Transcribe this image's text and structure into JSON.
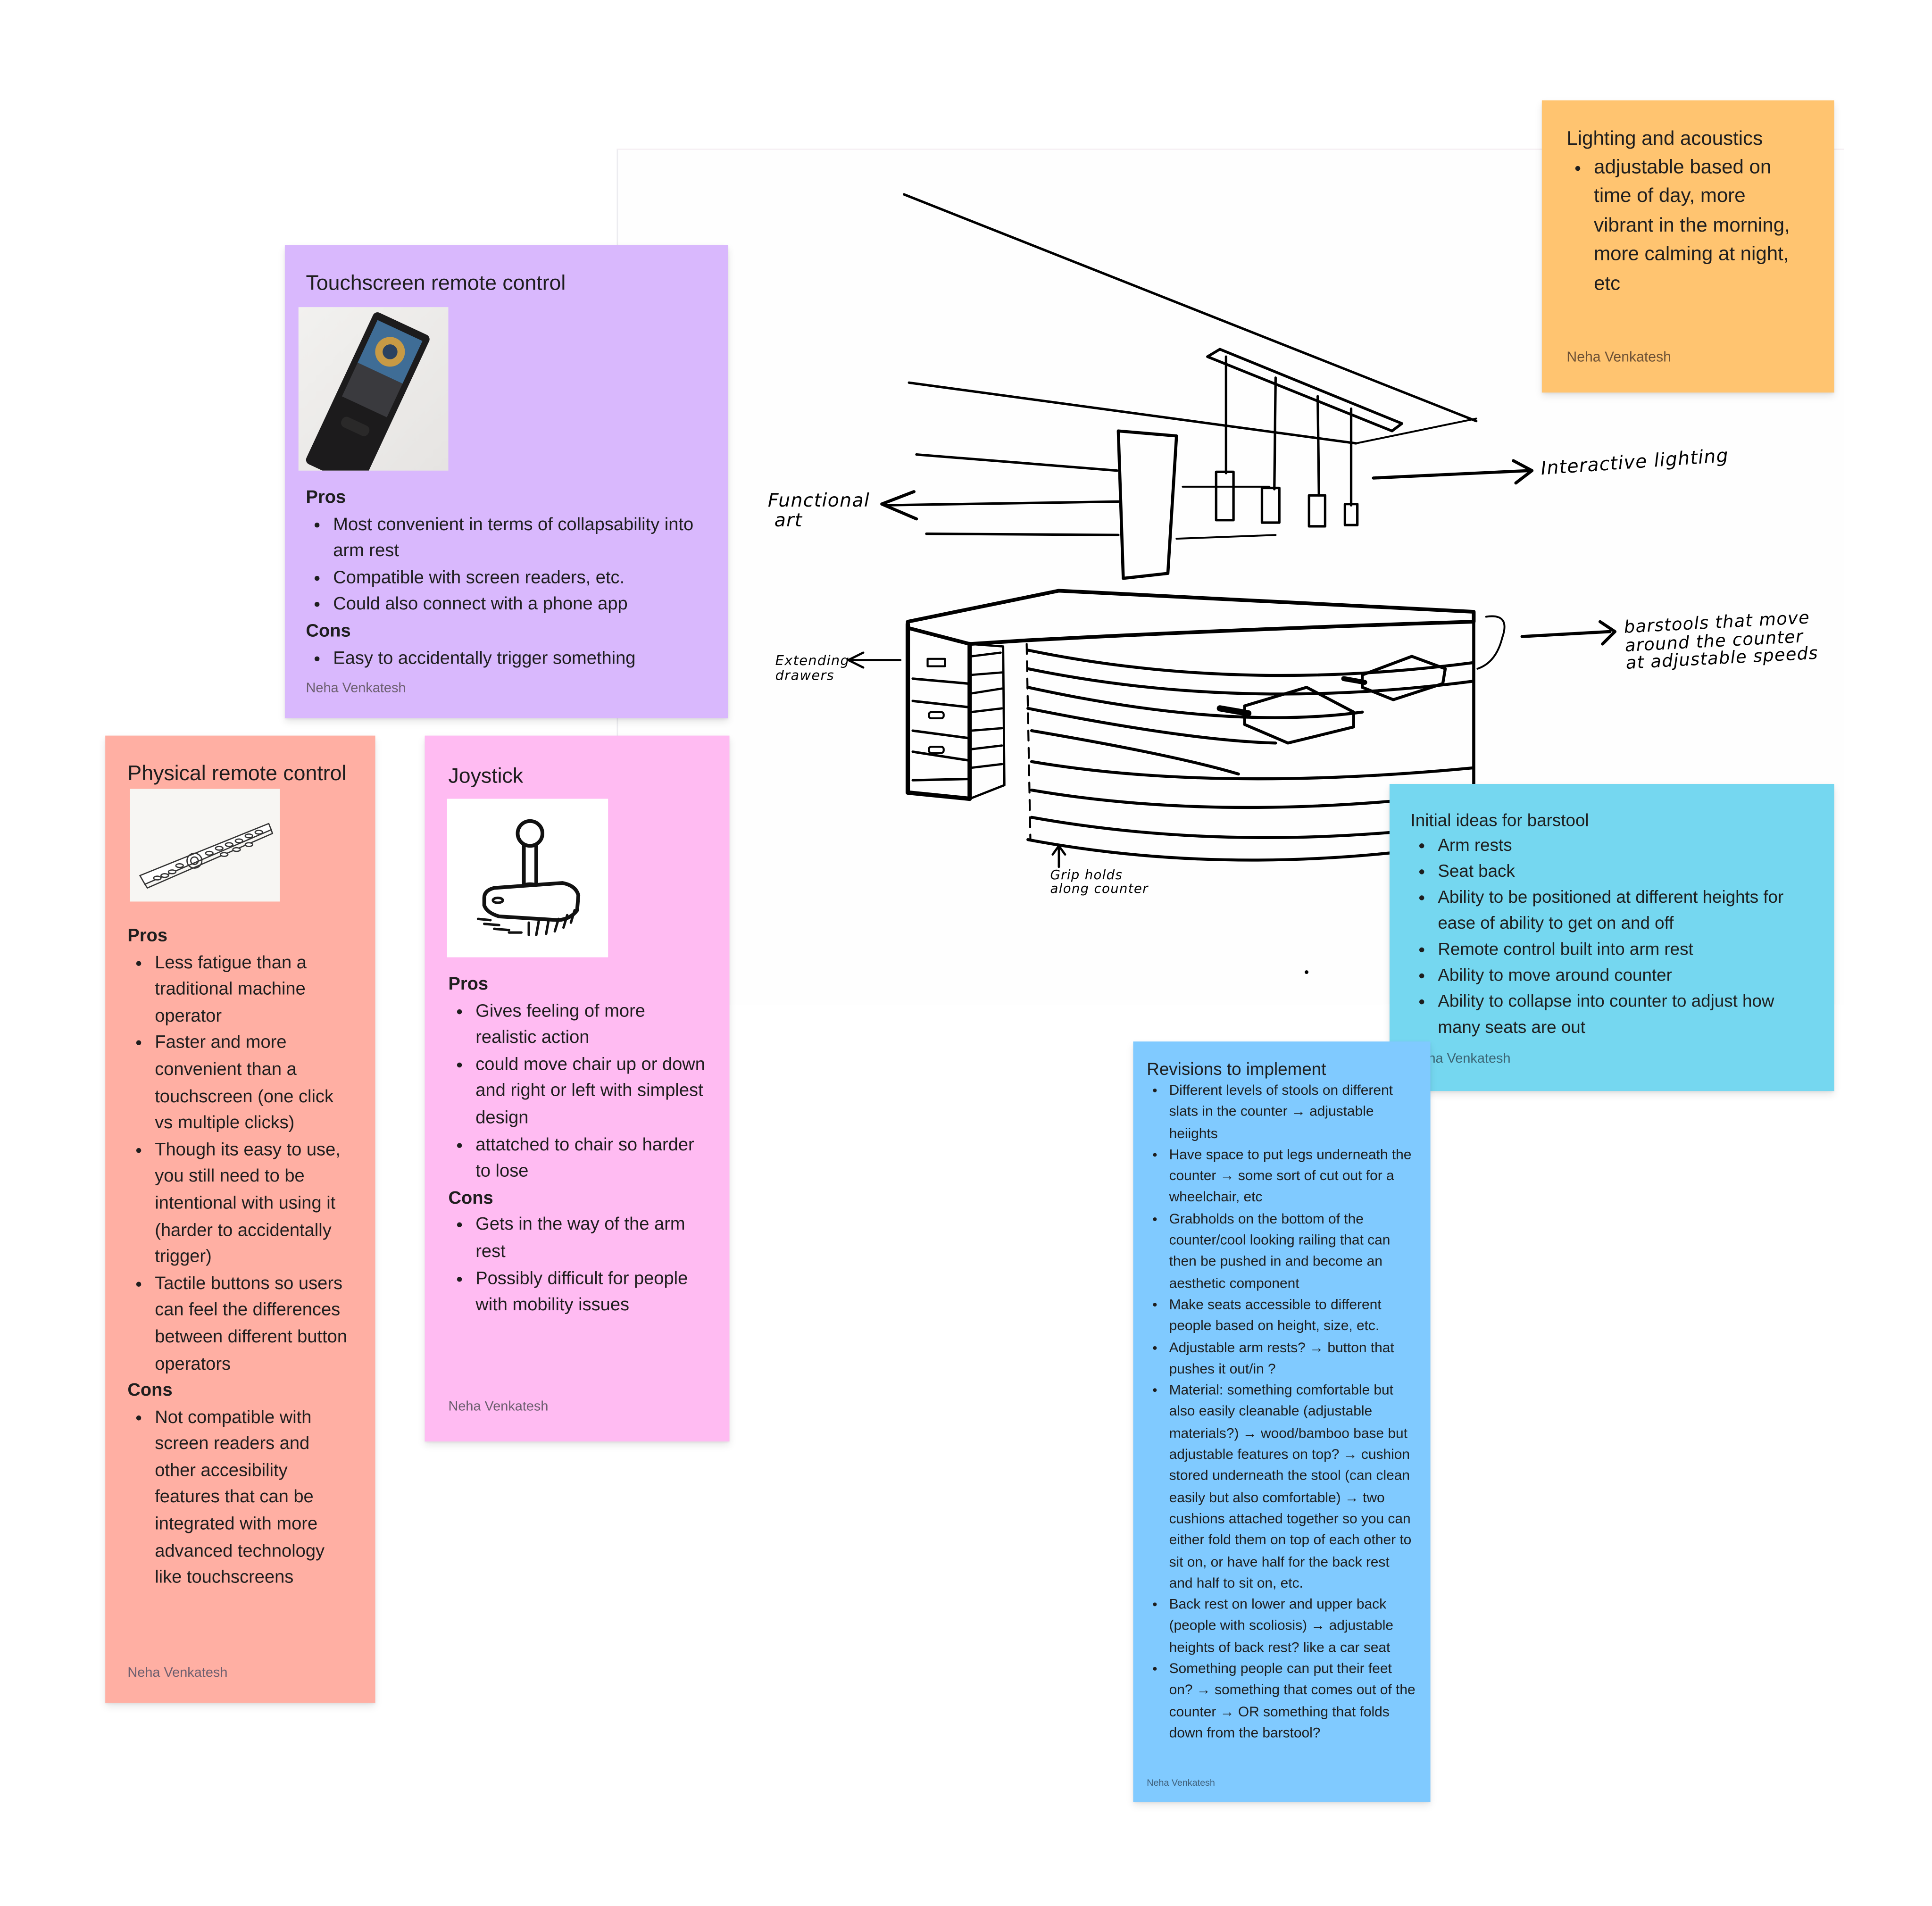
{
  "canvas": {
    "sketch": {
      "labels": {
        "functional_art": "Functional\n art",
        "interactive_lighting": "Interactive lighting",
        "barstools": "barstools that move\naround the counter\nat adjustable speeds",
        "extending_drawers": "Extending\ndrawers",
        "grip_holds": "Grip holds\nalong counter"
      }
    },
    "stickies": {
      "touchscreen": {
        "color": "#d9b8fd",
        "title": "Touchscreen remote control",
        "image_alt": "touchscreen-remote-photo",
        "pros_label": "Pros",
        "pros": [
          "Most convenient in terms of collapsability into arm rest",
          "Compatible with screen readers, etc.",
          "Could also connect with a phone app"
        ],
        "cons_label": "Cons",
        "cons": [
          "Easy to accidentally trigger something"
        ],
        "author": "Neha Venkatesh"
      },
      "physical": {
        "color": "#ffafa3",
        "title": "Physical remote control",
        "image_alt": "physical-remote-drawing",
        "pros_label": "Pros",
        "pros": [
          "Less fatigue than a traditional machine operator",
          "Faster and more convenient than a touchscreen (one click vs multiple clicks)",
          "Though its easy to use, you still need to be intentional with using it (harder to accidentally trigger)",
          "Tactile buttons so users can feel the differences between different button operators"
        ],
        "cons_label": "Cons",
        "cons": [
          "Not compatible with screen readers and other accesibility features that can be integrated with more advanced technology like touchscreens"
        ],
        "author": "Neha Venkatesh"
      },
      "joystick": {
        "color": "#ffbbf2",
        "title": "Joystick",
        "image_alt": "joystick-drawing",
        "pros_label": "Pros",
        "pros": [
          "Gives feeling of more realistic action",
          "could move chair up or down and right or left with simplest design",
          "attatched to chair so harder to lose"
        ],
        "cons_label": "Cons",
        "cons": [
          "Gets in the way of the arm rest",
          "Possibly difficult for people with mobility issues"
        ],
        "author": "Neha Venkatesh"
      },
      "lighting": {
        "color": "#ffc470",
        "title": "Lighting and acoustics",
        "items": [
          "adjustable based on time of day, more vibrant in the morning, more calming at night, etc"
        ],
        "author": "Neha Venkatesh"
      },
      "barstool": {
        "color": "#75d7f0",
        "title": "Initial ideas for barstool",
        "items": [
          "Arm rests",
          "Seat back",
          "Ability to be positioned at different heights for ease of ability to get on and off",
          "Remote control built into arm rest",
          "Ability to move around counter",
          "Ability to collapse into counter to adjust how many seats are out"
        ],
        "author": "Neha Venkatesh"
      },
      "revisions": {
        "color": "#80caff",
        "title": "Revisions to implement",
        "items": [
          "Different levels of stools on different slats in the counter → adjustable heiights",
          "Have space to put legs underneath the counter → some sort of cut out for a wheelchair, etc",
          "Grabholds on the bottom of the counter/cool looking railing that can then be pushed in and become an aesthetic component",
          "Make seats accessible to different people based on height, size, etc.",
          "Adjustable arm rests? → button that pushes it out/in ?",
          "Material: something comfortable but also easily cleanable (adjustable materials?) → wood/bamboo base but adjustable features on top? → cushion stored underneath the stool (can clean easily but also comfortable) → two cushions attached together so you can either fold them on top of each other to sit on, or have half for the back rest and half to sit on, etc.",
          "Back rest on lower and upper back (people with scoliosis) → adjustable heights of back rest? like a car seat",
          "Something people can put their feet on? → something that comes out of the counter → OR something that folds down from the barstool?"
        ],
        "author": "Neha Venkatesh"
      }
    }
  }
}
